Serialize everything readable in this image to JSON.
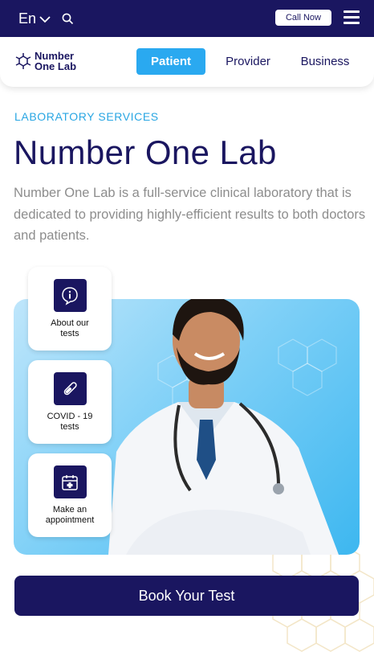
{
  "header": {
    "language": "En",
    "call_label": "Call Now"
  },
  "nav": {
    "logo_line1": "Number",
    "logo_line2": "One Lab",
    "tabs": [
      "Patient",
      "Provider",
      "Business"
    ],
    "active_tab": "Patient"
  },
  "hero": {
    "eyebrow": "LABORATORY SERVICES",
    "title": "Number One Lab",
    "description": "Number One Lab is a full-service clinical laboratory that is dedicated to providing highly-efficient results to both doctors and patients."
  },
  "cards": [
    {
      "line1": "About our",
      "line2": "tests",
      "icon": "info-icon"
    },
    {
      "line1": "COVID - 19",
      "line2": "tests",
      "icon": "test-tube-icon"
    },
    {
      "line1": "Make an",
      "line2": "appointment",
      "icon": "calendar-icon"
    }
  ],
  "cta": {
    "book_label": "Book Your Test"
  },
  "colors": {
    "navy": "#1a1660",
    "accent": "#2aa9f0"
  }
}
